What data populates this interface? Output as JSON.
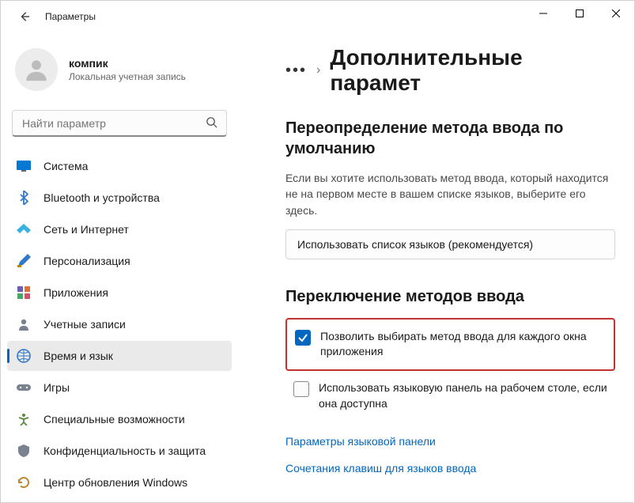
{
  "window": {
    "title": "Параметры"
  },
  "account": {
    "name": "компик",
    "subtitle": "Локальная учетная запись"
  },
  "search": {
    "placeholder": "Найти параметр"
  },
  "sidebar": {
    "items": [
      {
        "label": "Система"
      },
      {
        "label": "Bluetooth и устройства"
      },
      {
        "label": "Сеть и Интернет"
      },
      {
        "label": "Персонализация"
      },
      {
        "label": "Приложения"
      },
      {
        "label": "Учетные записи"
      },
      {
        "label": "Время и язык"
      },
      {
        "label": "Игры"
      },
      {
        "label": "Специальные возможности"
      },
      {
        "label": "Конфиденциальность и защита"
      },
      {
        "label": "Центр обновления Windows"
      }
    ]
  },
  "breadcrumb": {
    "page_title": "Дополнительные парамет"
  },
  "section1": {
    "heading": "Переопределение метода ввода по умолчанию",
    "description": "Если вы хотите использовать метод ввода, который находится не на первом месте в вашем списке языков, выберите его здесь.",
    "select_value": "Использовать список языков (рекомендуется)"
  },
  "section2": {
    "heading": "Переключение методов ввода",
    "checkbox1_label": "Позволить выбирать метод ввода для каждого окна приложения",
    "checkbox2_label": "Использовать языковую панель на рабочем столе, если она доступна"
  },
  "links": {
    "link1": "Параметры языковой панели",
    "link2": "Сочетания клавиш для языков ввода"
  }
}
